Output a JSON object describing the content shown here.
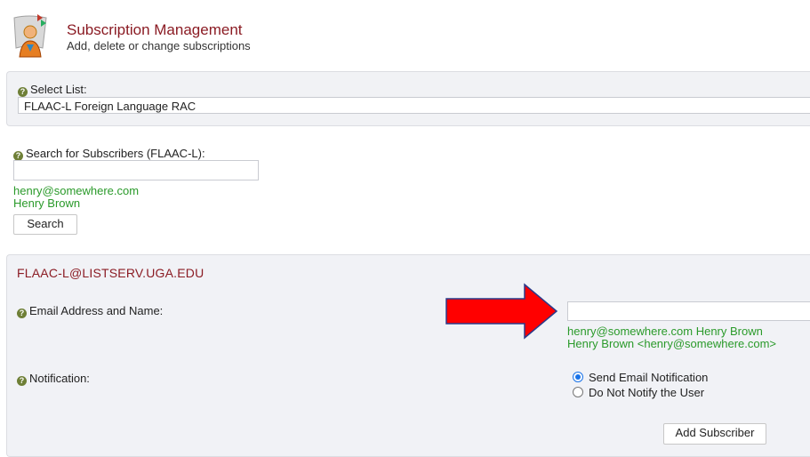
{
  "header": {
    "icon": "user-subscription-icon",
    "title": "Subscription Management",
    "subtitle": "Add, delete or change subscriptions"
  },
  "select_list": {
    "label": "Select List:",
    "value": "FLAAC-L Foreign Language RAC"
  },
  "search": {
    "label": "Search for Subscribers (FLAAC-L):",
    "value": "",
    "example_email": "henry@somewhere.com",
    "example_name": "Henry Brown",
    "button": "Search"
  },
  "add_panel": {
    "list_address": "FLAAC-L@LISTSERV.UGA.EDU",
    "email_label": "Email Address and Name:",
    "email_value": "",
    "email_example1": "henry@somewhere.com Henry Brown",
    "email_example2": "Henry Brown <henry@somewhere.com>",
    "notification_label": "Notification:",
    "notify_options": [
      {
        "label": "Send Email Notification",
        "selected": true
      },
      {
        "label": "Do Not Notify the User",
        "selected": false
      }
    ],
    "add_button": "Add Subscriber"
  },
  "colors": {
    "title_red": "#8b1c24",
    "example_green": "#2a9a2a",
    "arrow_red": "#ff0000",
    "arrow_outline": "#2a3a8a"
  }
}
